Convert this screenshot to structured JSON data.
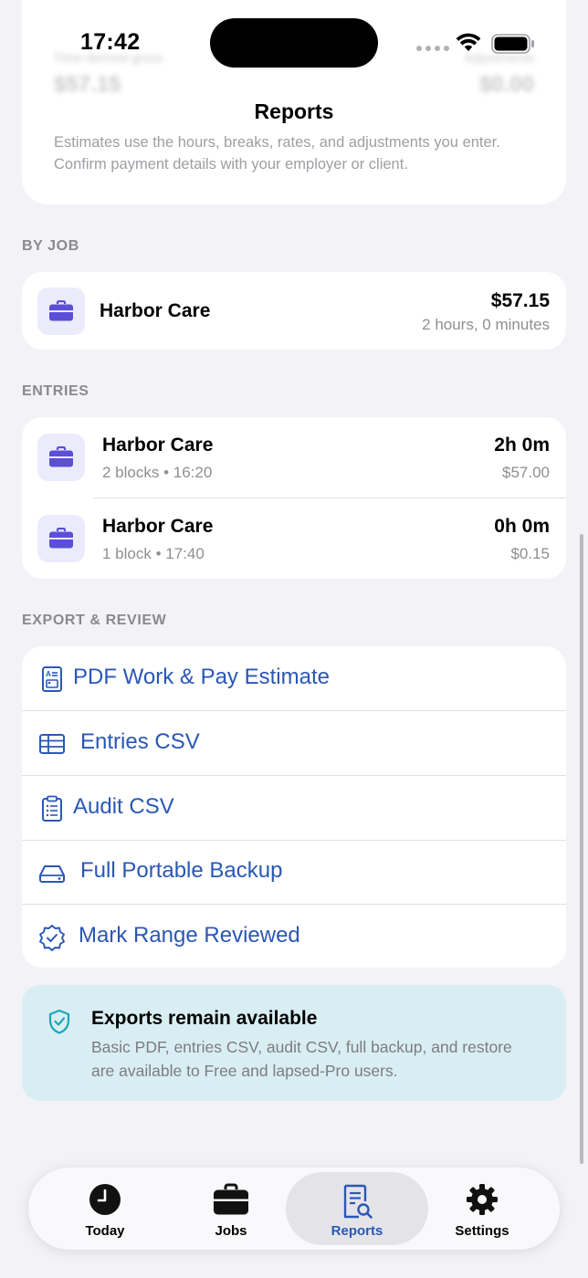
{
  "status_bar": {
    "time": "17:42"
  },
  "behind_header": {
    "left_label": "Time-derived gross",
    "left_value": "$57.15",
    "right_label": "Adjustments",
    "right_value": "$0.00"
  },
  "nav": {
    "title": "Reports"
  },
  "summary": {
    "note": "Estimates use the hours, breaks, rates, and adjustments you enter. Confirm payment details with your employer or client."
  },
  "by_job": {
    "header": "BY JOB",
    "items": [
      {
        "name": "Harbor Care",
        "amount": "$57.15",
        "duration": "2 hours, 0 minutes",
        "icon": "briefcase-icon"
      }
    ]
  },
  "entries": {
    "header": "ENTRIES",
    "items": [
      {
        "name": "Harbor Care",
        "meta": "2 blocks • 16:20",
        "duration": "2h 0m",
        "amount": "$57.00"
      },
      {
        "name": "Harbor Care",
        "meta": "1 block • 17:40",
        "duration": "0h 0m",
        "amount": "$0.15"
      }
    ]
  },
  "export": {
    "header": "EXPORT & REVIEW",
    "items": [
      {
        "label": "PDF Work & Pay Estimate",
        "icon": "pdf-document-icon"
      },
      {
        "label": "Entries CSV",
        "icon": "table-icon"
      },
      {
        "label": "Audit CSV",
        "icon": "clipboard-list-icon"
      },
      {
        "label": "Full Portable Backup",
        "icon": "drive-icon"
      },
      {
        "label": "Mark Range Reviewed",
        "icon": "checkmark-seal-icon"
      }
    ]
  },
  "info": {
    "title": "Exports remain available",
    "body": "Basic PDF, entries CSV, audit CSV, full backup, and restore are available to Free and lapsed-Pro users."
  },
  "tabs": [
    {
      "label": "Today",
      "icon": "clock-icon",
      "active": false
    },
    {
      "label": "Jobs",
      "icon": "briefcase-icon",
      "active": false
    },
    {
      "label": "Reports",
      "icon": "report-search-icon",
      "active": true
    },
    {
      "label": "Settings",
      "icon": "gear-icon",
      "active": false
    }
  ],
  "colors": {
    "accent": "#2a57b5",
    "job_icon": "#5b4fd6",
    "info_bg": "#d9eef2",
    "shield": "#1aa7b8"
  }
}
